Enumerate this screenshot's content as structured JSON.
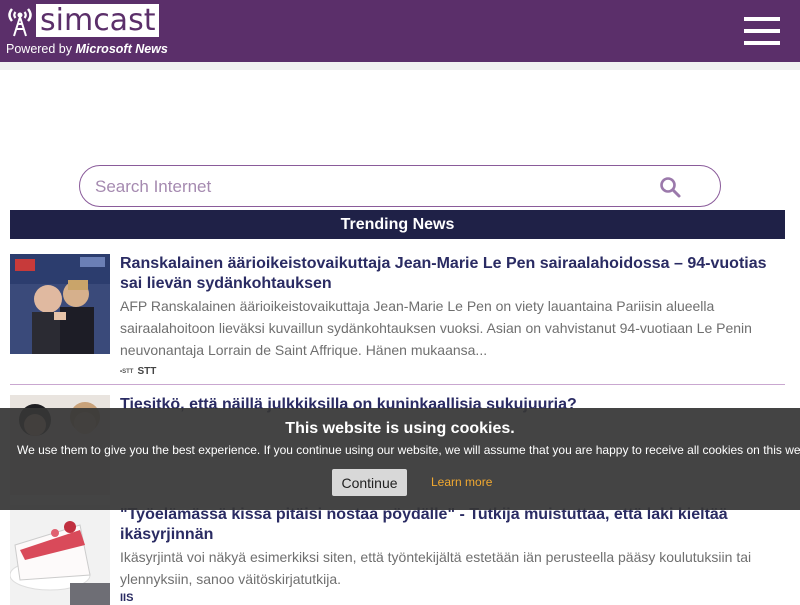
{
  "header": {
    "logo_text": "simcast",
    "powered_prefix": "Powered by ",
    "powered_brand": "Microsoft News",
    "menu_icon": "hamburger-menu-icon"
  },
  "search": {
    "placeholder": "Search Internet",
    "icon": "search-icon"
  },
  "trending": {
    "label": "Trending News"
  },
  "articles": [
    {
      "title": "Ranskalainen äärioikeistovaikuttaja Jean-Marie Le Pen sairaalahoidossa – 94-vuotias sai lievän sydänkohtauksen",
      "description": "AFP Ranskalainen äärioikeistovaikuttaja Jean-Marie Le Pen on viety lauantaina Pariisin alueella sairaalahoitoon lieväksi kuvaillun sydänkohtauksen vuoksi. Asian on vahvistanut 94-vuotiaan Le Penin neuvonantaja Lorrain de Saint Affrique. Hänen mukaansa...",
      "source": "STT",
      "source_logo": "•STT"
    },
    {
      "title": "Tiesitkö, että näillä julkkiksilla on kuninkaallisia sukujuuria?",
      "description": "",
      "source": ""
    },
    {
      "title": "\"Työelämässä kissa pitäisi nostaa pöydälle\" - Tutkija muistuttaa, että laki kieltää ikäsyrjinnän",
      "description": "Ikäsyrjintä voi näkyä esimerkiksi siten, että työntekijältä estetään iän perusteella pääsy koulutuksiin tai ylennyksiin, sanoo väitöskirjatutkija.",
      "source": "IIS"
    }
  ],
  "cookie": {
    "title": "This website is using cookies.",
    "text": "We use them to give you the best experience. If you continue using our website, we will assume that you are happy to receive all cookies on this website.",
    "button": "Continue",
    "link": "Learn more"
  },
  "colors": {
    "header_bg": "#5b2f6a",
    "trending_bg": "#1f2147",
    "title_text": "#2a2b63",
    "cookie_link": "#f0a830"
  }
}
